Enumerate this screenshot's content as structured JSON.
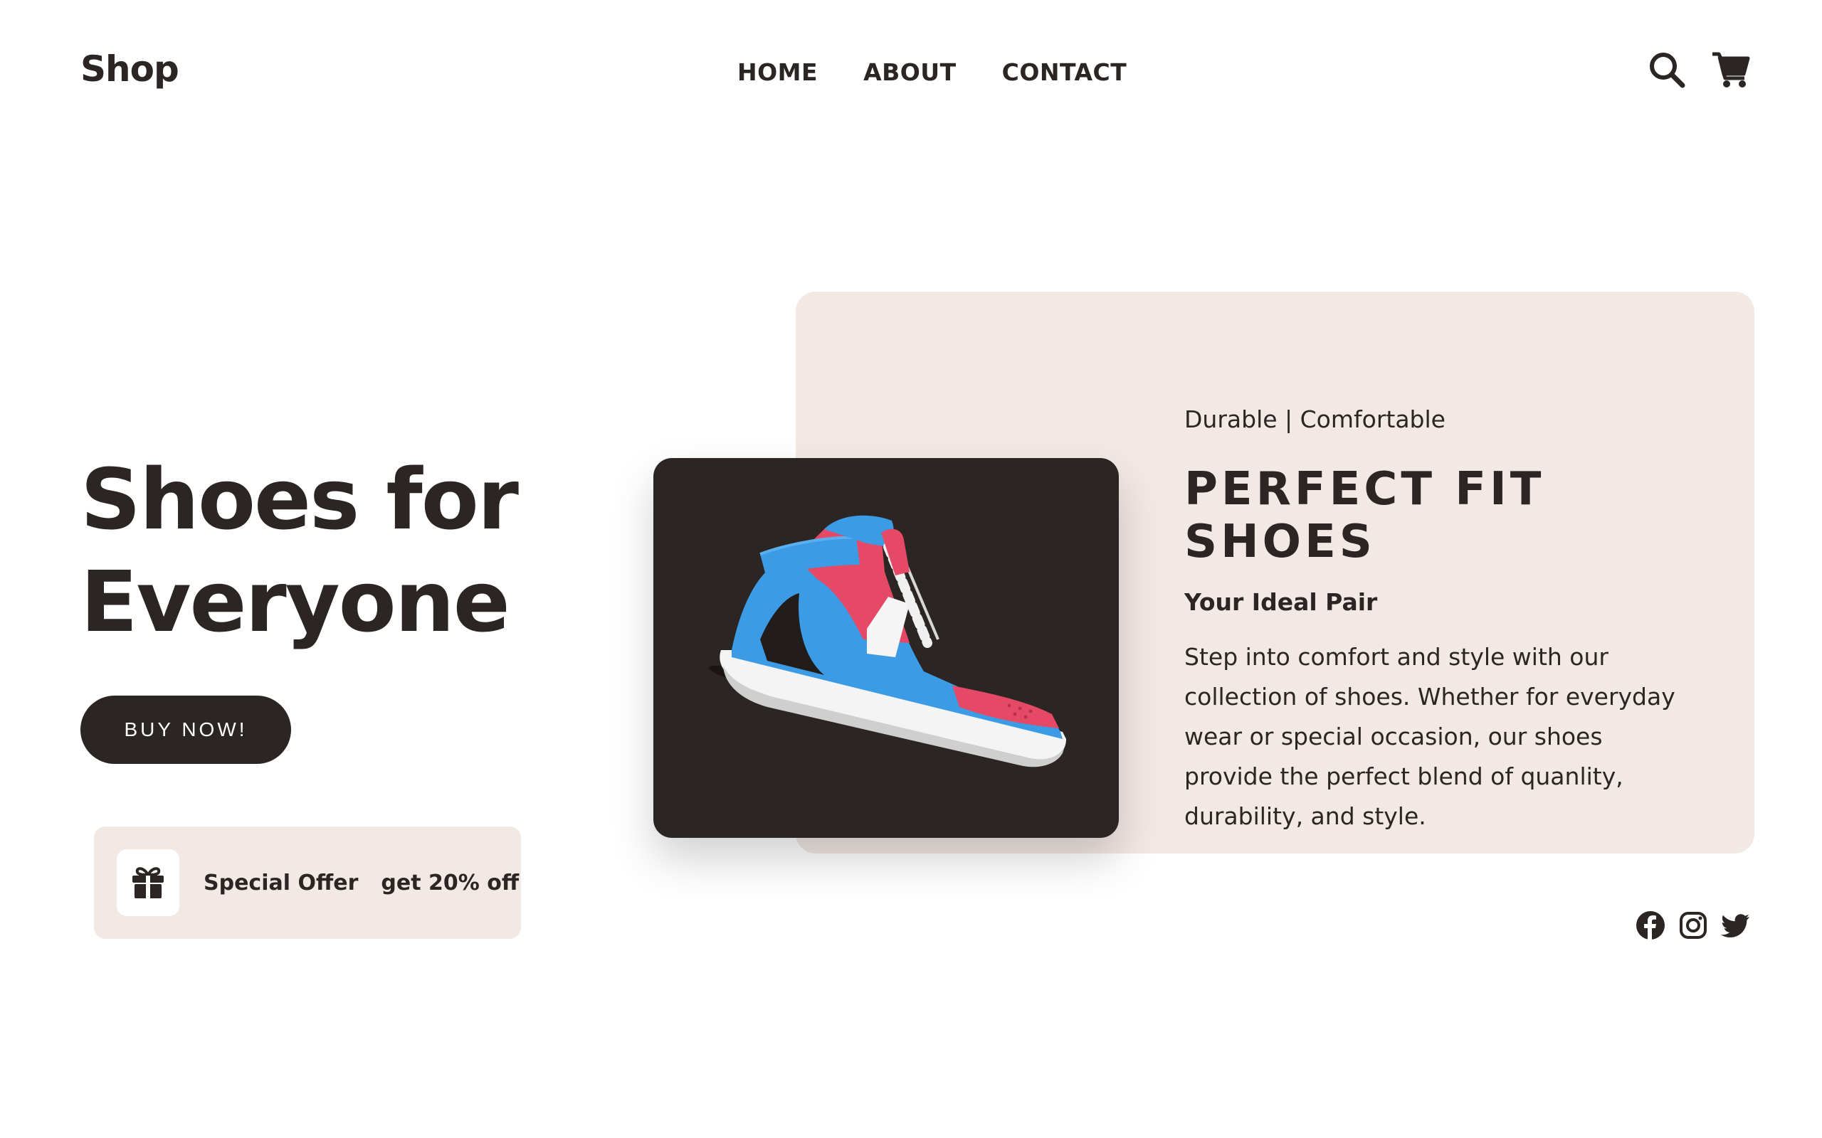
{
  "header": {
    "logo": "Shop",
    "nav": [
      {
        "label": "HOME",
        "icon": ""
      },
      {
        "label": "ABOUT",
        "icon": ""
      },
      {
        "label": "CONTACT",
        "icon": ""
      }
    ],
    "icons": [
      "search-icon",
      "cart-icon"
    ]
  },
  "hero": {
    "title_line1": "Shoes for",
    "title_line2": "Everyone",
    "cta_label": "BUY NOW!"
  },
  "offer": {
    "icon": "gift-icon",
    "title": "Special Offer",
    "text": "get 20% off"
  },
  "card": {
    "tagline": "Durable | Comfortable",
    "title": "PERFECT FIT SHOES",
    "subtitle": "Your Ideal Pair",
    "description": "Step into comfort and style with our collection of shoes. Whether for everyday wear or special occasion, our shoes provide the perfect blend of quanlity, durability, and style.",
    "product_image": "sneaker-image"
  },
  "social": [
    "facebook-icon",
    "instagram-icon",
    "twitter-icon"
  ],
  "colors": {
    "dark": "#2b2523",
    "card_bg": "#f2e8e4",
    "white": "#ffffff"
  }
}
